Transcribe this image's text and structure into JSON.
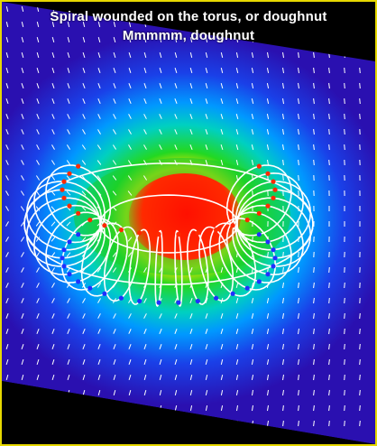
{
  "figure": {
    "title": "Spiral wounded on the torus, or doughnut",
    "subtitle": "Mmmmm, doughnut",
    "colors": {
      "border": "#e6d800",
      "background": "#000000",
      "field_low": "#1c00b4",
      "field_mid": "#00b0ff",
      "field_green": "#20d020",
      "field_high": "#ff2000",
      "vectors": "#ffffff",
      "wire": "#ffffff"
    }
  }
}
